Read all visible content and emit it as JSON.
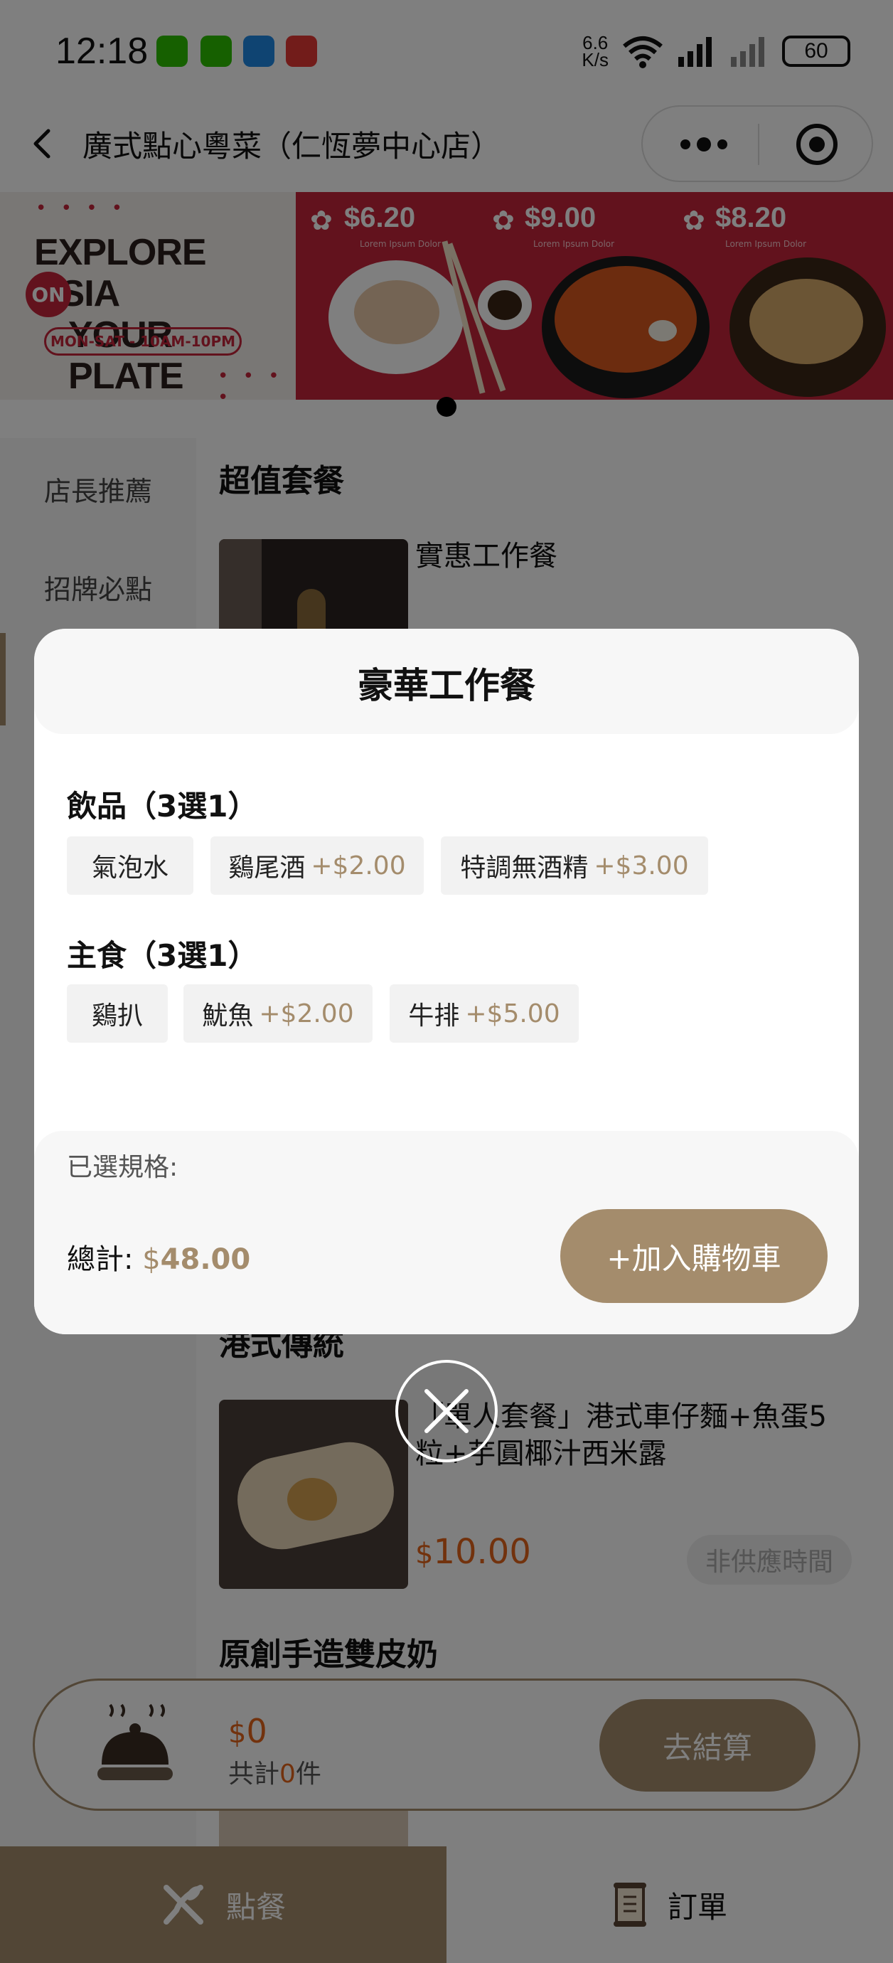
{
  "status_bar": {
    "time": "12:18",
    "net_speed_top": "6.6",
    "net_speed_unit": "K/s",
    "wifi_label": "6",
    "battery": "60"
  },
  "header": {
    "store_name": "廣式點心粵菜（仁恆夢中心店）"
  },
  "banner": {
    "headline_line1": "EXPLORE ASIA",
    "headline_line2": "YOUR PLATE",
    "on_badge": "ON",
    "hours": "MON-SAT - 10AM-10PM",
    "prices": [
      "$6.20",
      "$9.00",
      "$8.20"
    ],
    "price_caption": "Lorem Ipsum Dolor"
  },
  "sidebar": {
    "items": [
      {
        "label": "店長推薦"
      },
      {
        "label": "招牌必點"
      }
    ]
  },
  "menu": {
    "section1_title": "超值套餐",
    "item1_name": "實惠工作餐",
    "section2_title": "港式傳統",
    "item2_name": "「單人套餐」港式車仔麵+魚蛋5粒+芋圓椰汁西米露",
    "item2_price_symbol": "$",
    "item2_price": "10.00",
    "item2_status": "非供應時間",
    "section3_title": "原創手造雙皮奶"
  },
  "cart": {
    "amount_symbol": "$",
    "amount": "0",
    "count_prefix": "共計",
    "count": "0",
    "count_suffix": "件",
    "checkout_label": "去結算"
  },
  "tabs": {
    "order_label": "點餐",
    "orders_label": "訂單"
  },
  "modal": {
    "title": "豪華工作餐",
    "groups": [
      {
        "title": "飲品（3選1）",
        "options": [
          {
            "name": "氣泡水",
            "extra": ""
          },
          {
            "name": "鷄尾酒",
            "extra": "+$2.00"
          },
          {
            "name": "特調無酒精",
            "extra": "+$3.00"
          }
        ]
      },
      {
        "title": "主食（3選1）",
        "options": [
          {
            "name": "鷄扒",
            "extra": ""
          },
          {
            "name": "魷魚",
            "extra": "+$2.00"
          },
          {
            "name": "牛排",
            "extra": "+$5.00"
          }
        ]
      }
    ],
    "selected_label": "已選規格:",
    "total_label": "總計:",
    "total_symbol": "$",
    "total_value": "48.00",
    "add_to_cart_label": "+加入購物車"
  },
  "colors": {
    "accent": "#a48c6c",
    "price": "#e4651a",
    "banner_red": "#c5253a"
  }
}
